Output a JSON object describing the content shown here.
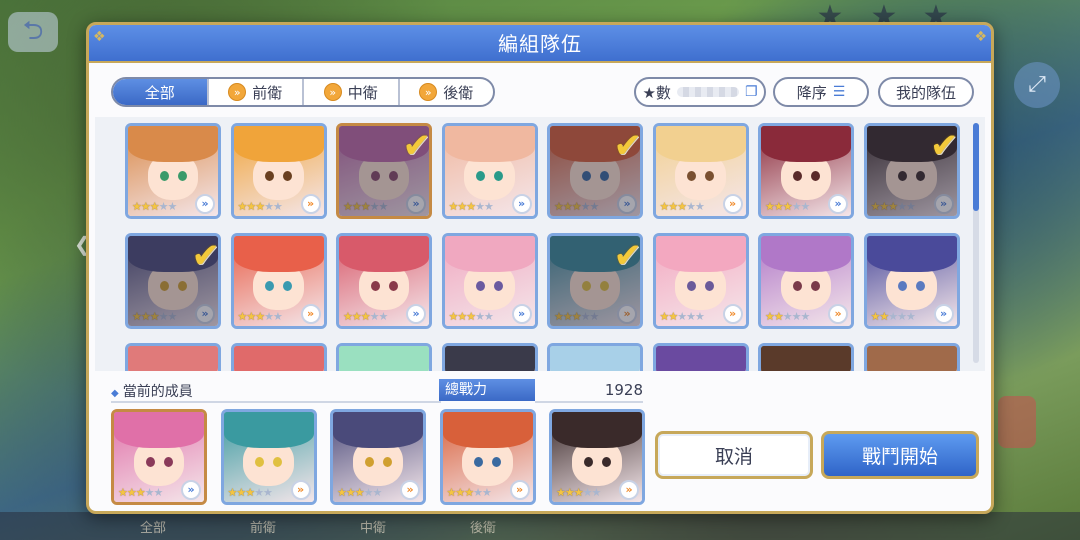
{
  "dialog": {
    "title": "編組隊伍"
  },
  "tabs": [
    {
      "label": "全部",
      "active": true
    },
    {
      "label": "前衛",
      "active": false
    },
    {
      "label": "中衛",
      "active": false
    },
    {
      "label": "後衛",
      "active": false
    }
  ],
  "filters": {
    "stars_label": "★數",
    "sort_label": "降序",
    "my_team_label": "我的隊伍"
  },
  "roster": [
    {
      "stars": 3,
      "selected": false,
      "hair": "#d98a4a",
      "eye": "#3a9a6a",
      "rank": "blue",
      "frame": "blue"
    },
    {
      "stars": 3,
      "selected": false,
      "hair": "#f0a43a",
      "eye": "#6a4020",
      "rank": "orange",
      "frame": "blue"
    },
    {
      "stars": 3,
      "selected": true,
      "hair": "#c06aa8",
      "eye": "#8a4a6a",
      "rank": "blue",
      "frame": "gold"
    },
    {
      "stars": 3,
      "selected": false,
      "hair": "#f0b8a0",
      "eye": "#2a9a8a",
      "rank": "blue",
      "frame": "blue"
    },
    {
      "stars": 3,
      "selected": true,
      "hair": "#d8603a",
      "eye": "#3a6aa0",
      "rank": "blue",
      "frame": "blue"
    },
    {
      "stars": 3,
      "selected": false,
      "hair": "#f2d090",
      "eye": "#7a5030",
      "rank": "orange",
      "frame": "blue"
    },
    {
      "stars": 3,
      "selected": false,
      "hair": "#8a2a3a",
      "eye": "#5a2a2a",
      "rank": "blue",
      "frame": "blue"
    },
    {
      "stars": 3,
      "selected": true,
      "hair": "#3a2a2a",
      "eye": "#3a2a2a",
      "rank": "blue",
      "frame": "blue"
    },
    {
      "stars": 3,
      "selected": true,
      "hair": "#4a4a7a",
      "eye": "#d0a030",
      "rank": "blue",
      "frame": "blue"
    },
    {
      "stars": 3,
      "selected": false,
      "hair": "#e8604a",
      "eye": "#3a9ab0",
      "rank": "orange",
      "frame": "blue"
    },
    {
      "stars": 3,
      "selected": false,
      "hair": "#d85a6a",
      "eye": "#8a3a4a",
      "rank": "blue",
      "frame": "blue"
    },
    {
      "stars": 3,
      "selected": false,
      "hair": "#f0a8c0",
      "eye": "#6a5aa0",
      "rank": "blue",
      "frame": "blue"
    },
    {
      "stars": 3,
      "selected": true,
      "hair": "#3a8a9a",
      "eye": "#e0c040",
      "rank": "orange",
      "frame": "blue"
    },
    {
      "stars": 2,
      "selected": false,
      "hair": "#f3a8c0",
      "eye": "#6a5a9a",
      "rank": "orange",
      "frame": "blue"
    },
    {
      "stars": 2,
      "selected": false,
      "hair": "#b078c8",
      "eye": "#7a3a4a",
      "rank": "orange",
      "frame": "blue"
    },
    {
      "stars": 2,
      "selected": false,
      "hair": "#4a4a9a",
      "eye": "#5a7ac0",
      "rank": "blue",
      "frame": "blue"
    },
    {
      "stars": 0,
      "selected": false,
      "hair": "#e07a7a",
      "eye": "#6a3a3a",
      "rank": "blue",
      "frame": "blue"
    },
    {
      "stars": 0,
      "selected": false,
      "hair": "#e06a6a",
      "eye": "#6a3a3a",
      "rank": "blue",
      "frame": "blue"
    },
    {
      "stars": 0,
      "selected": false,
      "hair": "#9ae0c0",
      "eye": "#3a6a5a",
      "rank": "blue",
      "frame": "blue"
    },
    {
      "stars": 0,
      "selected": false,
      "hair": "#3a3a4a",
      "eye": "#3a3a4a",
      "rank": "blue",
      "frame": "blue"
    },
    {
      "stars": 0,
      "selected": false,
      "hair": "#a8d0e8",
      "eye": "#3a5a7a",
      "rank": "blue",
      "frame": "blue"
    },
    {
      "stars": 0,
      "selected": false,
      "hair": "#6a4aa0",
      "eye": "#4a3a6a",
      "rank": "blue",
      "frame": "blue"
    },
    {
      "stars": 0,
      "selected": false,
      "hair": "#5a3a2a",
      "eye": "#4a2a2a",
      "rank": "blue",
      "frame": "blue"
    },
    {
      "stars": 0,
      "selected": false,
      "hair": "#a06a4a",
      "eye": "#4a2a2a",
      "rank": "blue",
      "frame": "blue"
    }
  ],
  "members": {
    "label": "當前的成員",
    "power_label": "總戰力",
    "power_value": "1928",
    "list": [
      {
        "stars": 3,
        "hair": "#e070a8",
        "eye": "#8a3a5a",
        "rank": "blue",
        "frame": "gold"
      },
      {
        "stars": 3,
        "hair": "#3a9aa0",
        "eye": "#e0c040",
        "rank": "orange",
        "frame": "blue"
      },
      {
        "stars": 3,
        "hair": "#4a4a7a",
        "eye": "#d0a030",
        "rank": "orange",
        "frame": "blue"
      },
      {
        "stars": 3,
        "hair": "#d8603a",
        "eye": "#3a6aa0",
        "rank": "orange",
        "frame": "blue"
      },
      {
        "stars": 3,
        "hair": "#3a2a2a",
        "eye": "#3a2a2a",
        "rank": "orange",
        "frame": "blue"
      }
    ]
  },
  "buttons": {
    "cancel": "取消",
    "start": "戰鬥開始"
  },
  "background": {
    "bottom_tabs": [
      "全部",
      "前衛",
      "中衛",
      "後衛"
    ]
  }
}
